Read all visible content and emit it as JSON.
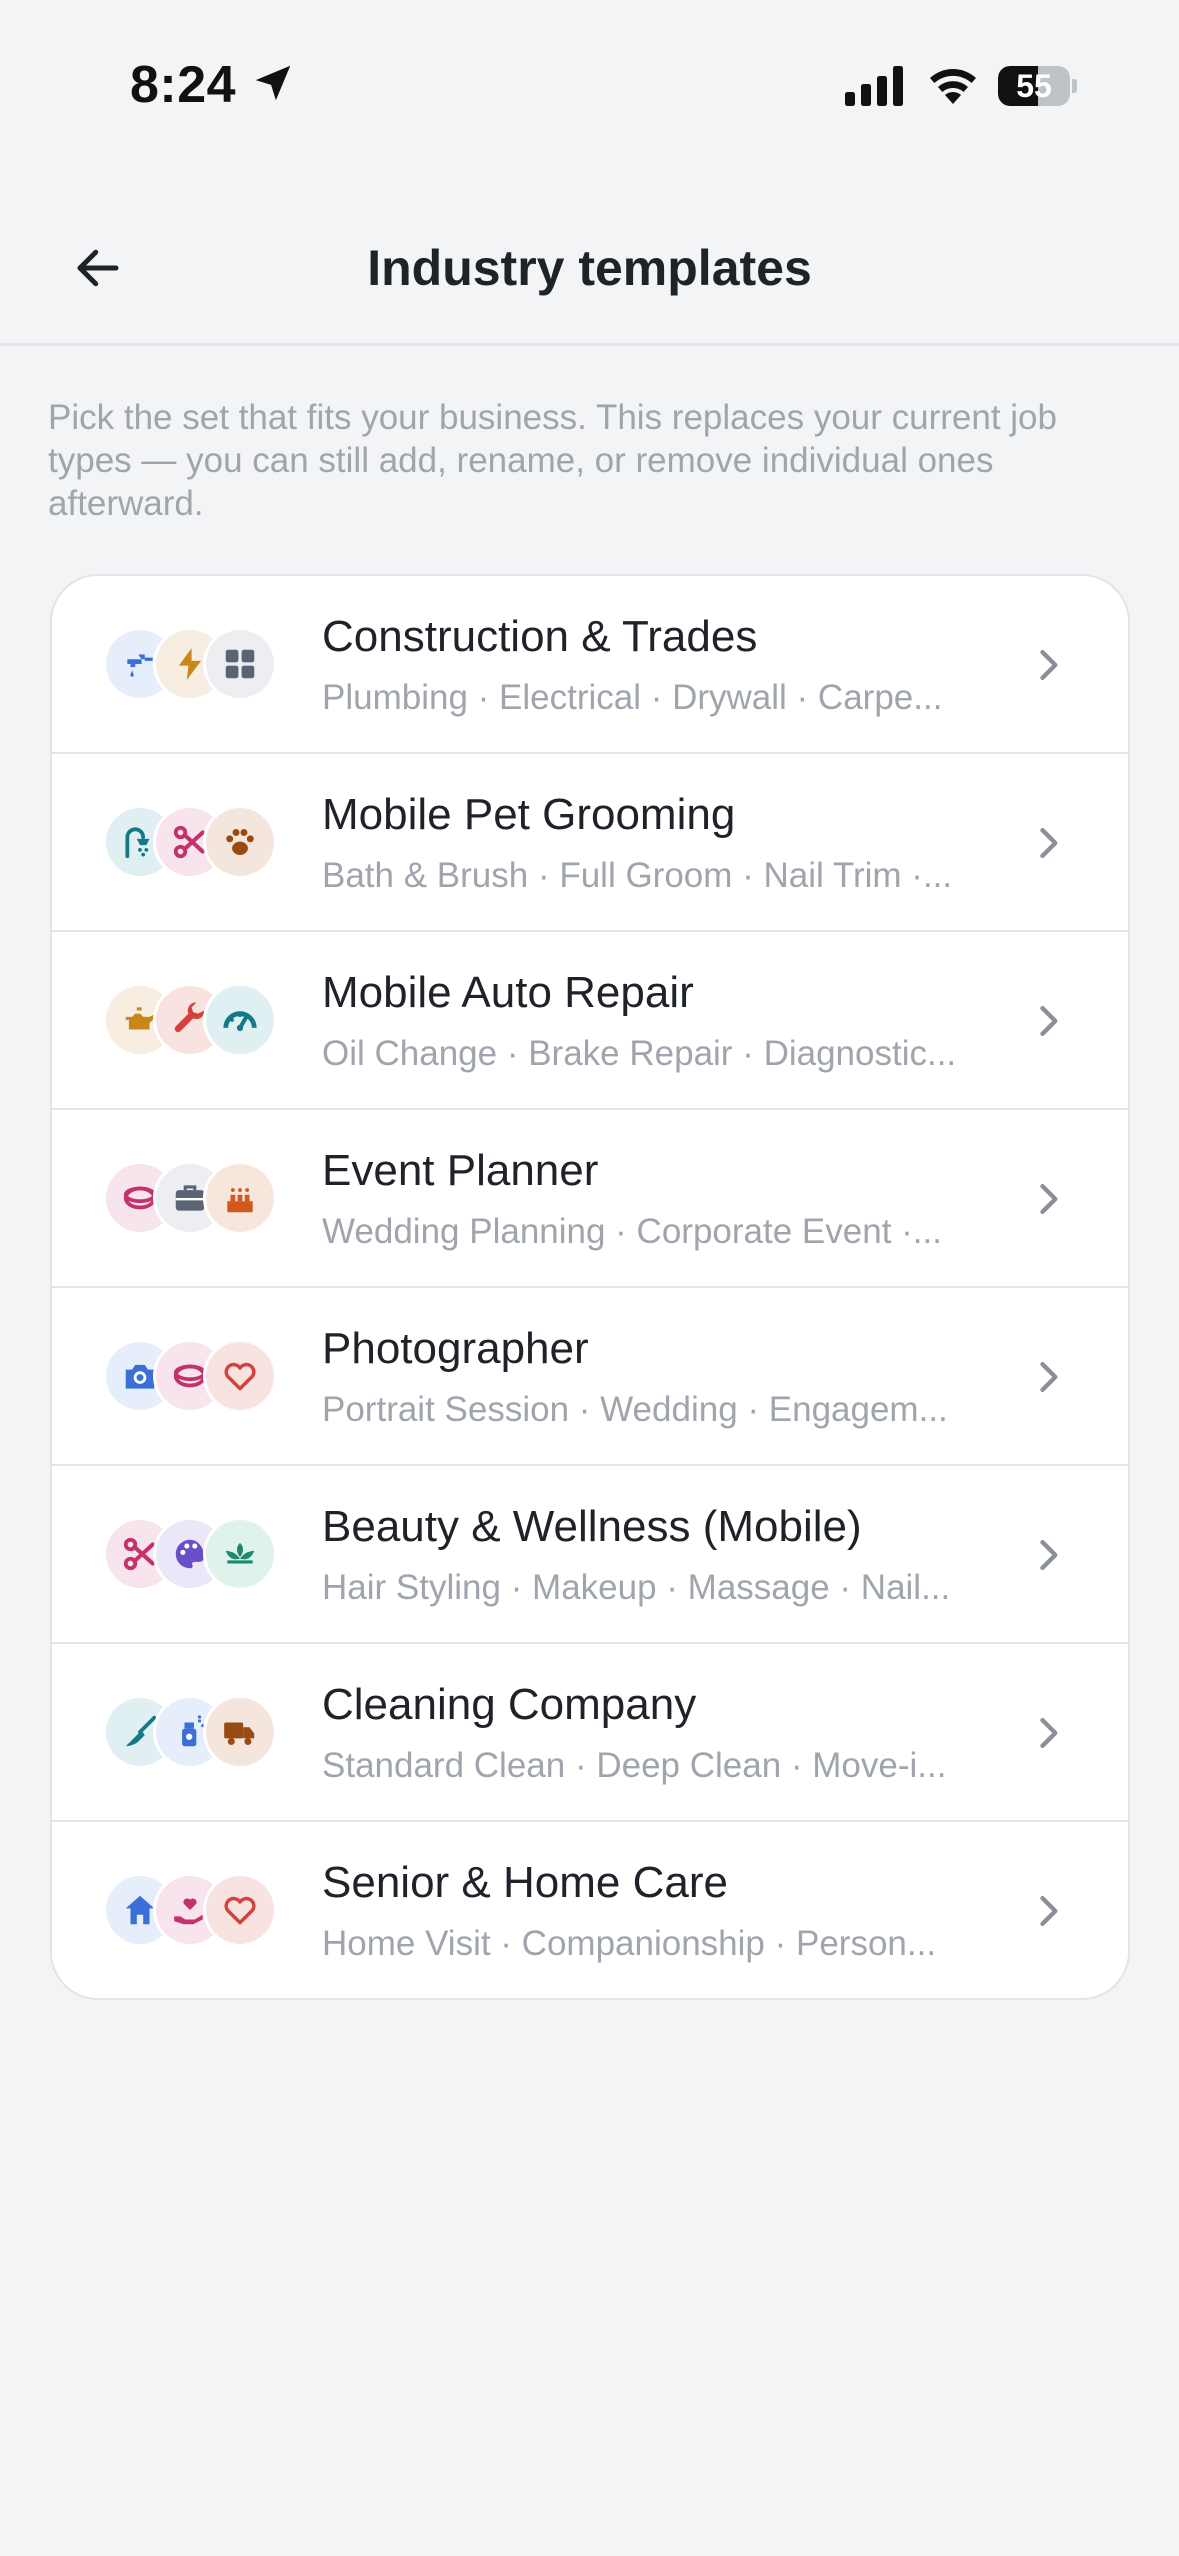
{
  "status_bar": {
    "time": "8:24",
    "battery_level": "55",
    "battery_level_fraction": 0.55
  },
  "header": {
    "title": "Industry templates",
    "back_icon": "arrow-left-icon"
  },
  "description": "Pick the set that fits your business. This replaces your current job types — you can still add, rename, or remove individual ones afterward.",
  "templates": [
    {
      "title": "Construction & Trades",
      "subtitle": "Plumbing · Electrical · Drywall · Carpe...",
      "icons": [
        {
          "name": "faucet-icon",
          "color": "#3b6fd6",
          "bg": "#e6eefb"
        },
        {
          "name": "lightning-icon",
          "color": "#c9871a",
          "bg": "#f7ede0"
        },
        {
          "name": "grid-tiles-icon",
          "color": "#5b6473",
          "bg": "#eceef1"
        }
      ]
    },
    {
      "title": "Mobile Pet Grooming",
      "subtitle": "Bath & Brush · Full Groom · Nail Trim ·...",
      "icons": [
        {
          "name": "shower-icon",
          "color": "#147a8a",
          "bg": "#e0f0f2"
        },
        {
          "name": "scissors-icon",
          "color": "#c4326e",
          "bg": "#f7e4ec"
        },
        {
          "name": "paw-icon",
          "color": "#9a4b14",
          "bg": "#f4e6dc"
        }
      ]
    },
    {
      "title": "Mobile Auto Repair",
      "subtitle": "Oil Change · Brake Repair · Diagnostic...",
      "icons": [
        {
          "name": "oil-can-icon",
          "color": "#c9871a",
          "bg": "#f7ede0"
        },
        {
          "name": "wrench-icon",
          "color": "#d3433c",
          "bg": "#f8e3e1"
        },
        {
          "name": "gauge-icon",
          "color": "#147a8a",
          "bg": "#e0f0f2"
        }
      ]
    },
    {
      "title": "Event Planner",
      "subtitle": "Wedding Planning · Corporate Event ·...",
      "icons": [
        {
          "name": "rings-icon",
          "color": "#c4326e",
          "bg": "#f7e4ec"
        },
        {
          "name": "briefcase-icon",
          "color": "#5b6473",
          "bg": "#eceef1"
        },
        {
          "name": "cake-icon",
          "color": "#d2581e",
          "bg": "#f8e6dc"
        }
      ]
    },
    {
      "title": "Photographer",
      "subtitle": "Portrait Session · Wedding · Engagem...",
      "icons": [
        {
          "name": "camera-icon",
          "color": "#3b6fd6",
          "bg": "#e6eefb"
        },
        {
          "name": "rings-icon",
          "color": "#c4326e",
          "bg": "#f7e4ec"
        },
        {
          "name": "heart-icon",
          "color": "#d3433c",
          "bg": "#f8e3e1"
        }
      ]
    },
    {
      "title": "Beauty & Wellness (Mobile)",
      "subtitle": "Hair Styling · Makeup · Massage · Nail...",
      "icons": [
        {
          "name": "scissors-icon",
          "color": "#c4326e",
          "bg": "#f7e4ec"
        },
        {
          "name": "palette-icon",
          "color": "#6a4fc9",
          "bg": "#ebe6f8"
        },
        {
          "name": "lotus-icon",
          "color": "#1d8a6c",
          "bg": "#e0f2ec"
        }
      ]
    },
    {
      "title": "Cleaning Company",
      "subtitle": "Standard Clean · Deep Clean · Move-i...",
      "icons": [
        {
          "name": "broom-icon",
          "color": "#147a8a",
          "bg": "#e0f0f2"
        },
        {
          "name": "spray-bottle-icon",
          "color": "#3b6fd6",
          "bg": "#e6eefb"
        },
        {
          "name": "truck-icon",
          "color": "#9a4b14",
          "bg": "#f4e6dc"
        }
      ]
    },
    {
      "title": "Senior & Home Care",
      "subtitle": "Home Visit · Companionship · Person...",
      "icons": [
        {
          "name": "home-icon",
          "color": "#3b6fd6",
          "bg": "#e6eefb"
        },
        {
          "name": "hand-heart-icon",
          "color": "#c4326e",
          "bg": "#f7e4ec"
        },
        {
          "name": "heart-icon",
          "color": "#d3433c",
          "bg": "#f8e3e1"
        }
      ]
    }
  ]
}
